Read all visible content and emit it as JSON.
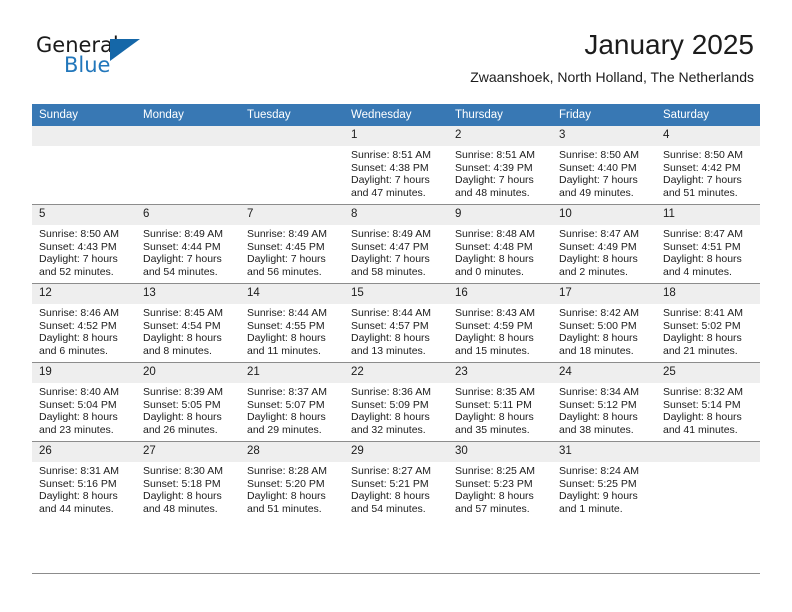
{
  "brand": {
    "name_top": "General",
    "name_bottom": "Blue",
    "logo_icon": "triangle-icon",
    "accent_color": "#1567a8",
    "blue_text_color": "#2277bb"
  },
  "header": {
    "title": "January 2025",
    "subtitle": "Zwaanshoek, North Holland, The Netherlands"
  },
  "calendar": {
    "header_background": "#3878b4",
    "header_text_color": "#ffffff",
    "daynum_background": "#eeeeee",
    "weekday_headers": [
      "Sunday",
      "Monday",
      "Tuesday",
      "Wednesday",
      "Thursday",
      "Friday",
      "Saturday"
    ],
    "weeks": [
      [
        {
          "day": "",
          "sunrise": "",
          "sunset": "",
          "daylight_line1": "",
          "daylight_line2": ""
        },
        {
          "day": "",
          "sunrise": "",
          "sunset": "",
          "daylight_line1": "",
          "daylight_line2": ""
        },
        {
          "day": "",
          "sunrise": "",
          "sunset": "",
          "daylight_line1": "",
          "daylight_line2": ""
        },
        {
          "day": "1",
          "sunrise": "Sunrise: 8:51 AM",
          "sunset": "Sunset: 4:38 PM",
          "daylight_line1": "Daylight: 7 hours",
          "daylight_line2": "and 47 minutes."
        },
        {
          "day": "2",
          "sunrise": "Sunrise: 8:51 AM",
          "sunset": "Sunset: 4:39 PM",
          "daylight_line1": "Daylight: 7 hours",
          "daylight_line2": "and 48 minutes."
        },
        {
          "day": "3",
          "sunrise": "Sunrise: 8:50 AM",
          "sunset": "Sunset: 4:40 PM",
          "daylight_line1": "Daylight: 7 hours",
          "daylight_line2": "and 49 minutes."
        },
        {
          "day": "4",
          "sunrise": "Sunrise: 8:50 AM",
          "sunset": "Sunset: 4:42 PM",
          "daylight_line1": "Daylight: 7 hours",
          "daylight_line2": "and 51 minutes."
        }
      ],
      [
        {
          "day": "5",
          "sunrise": "Sunrise: 8:50 AM",
          "sunset": "Sunset: 4:43 PM",
          "daylight_line1": "Daylight: 7 hours",
          "daylight_line2": "and 52 minutes."
        },
        {
          "day": "6",
          "sunrise": "Sunrise: 8:49 AM",
          "sunset": "Sunset: 4:44 PM",
          "daylight_line1": "Daylight: 7 hours",
          "daylight_line2": "and 54 minutes."
        },
        {
          "day": "7",
          "sunrise": "Sunrise: 8:49 AM",
          "sunset": "Sunset: 4:45 PM",
          "daylight_line1": "Daylight: 7 hours",
          "daylight_line2": "and 56 minutes."
        },
        {
          "day": "8",
          "sunrise": "Sunrise: 8:49 AM",
          "sunset": "Sunset: 4:47 PM",
          "daylight_line1": "Daylight: 7 hours",
          "daylight_line2": "and 58 minutes."
        },
        {
          "day": "9",
          "sunrise": "Sunrise: 8:48 AM",
          "sunset": "Sunset: 4:48 PM",
          "daylight_line1": "Daylight: 8 hours",
          "daylight_line2": "and 0 minutes."
        },
        {
          "day": "10",
          "sunrise": "Sunrise: 8:47 AM",
          "sunset": "Sunset: 4:49 PM",
          "daylight_line1": "Daylight: 8 hours",
          "daylight_line2": "and 2 minutes."
        },
        {
          "day": "11",
          "sunrise": "Sunrise: 8:47 AM",
          "sunset": "Sunset: 4:51 PM",
          "daylight_line1": "Daylight: 8 hours",
          "daylight_line2": "and 4 minutes."
        }
      ],
      [
        {
          "day": "12",
          "sunrise": "Sunrise: 8:46 AM",
          "sunset": "Sunset: 4:52 PM",
          "daylight_line1": "Daylight: 8 hours",
          "daylight_line2": "and 6 minutes."
        },
        {
          "day": "13",
          "sunrise": "Sunrise: 8:45 AM",
          "sunset": "Sunset: 4:54 PM",
          "daylight_line1": "Daylight: 8 hours",
          "daylight_line2": "and 8 minutes."
        },
        {
          "day": "14",
          "sunrise": "Sunrise: 8:44 AM",
          "sunset": "Sunset: 4:55 PM",
          "daylight_line1": "Daylight: 8 hours",
          "daylight_line2": "and 11 minutes."
        },
        {
          "day": "15",
          "sunrise": "Sunrise: 8:44 AM",
          "sunset": "Sunset: 4:57 PM",
          "daylight_line1": "Daylight: 8 hours",
          "daylight_line2": "and 13 minutes."
        },
        {
          "day": "16",
          "sunrise": "Sunrise: 8:43 AM",
          "sunset": "Sunset: 4:59 PM",
          "daylight_line1": "Daylight: 8 hours",
          "daylight_line2": "and 15 minutes."
        },
        {
          "day": "17",
          "sunrise": "Sunrise: 8:42 AM",
          "sunset": "Sunset: 5:00 PM",
          "daylight_line1": "Daylight: 8 hours",
          "daylight_line2": "and 18 minutes."
        },
        {
          "day": "18",
          "sunrise": "Sunrise: 8:41 AM",
          "sunset": "Sunset: 5:02 PM",
          "daylight_line1": "Daylight: 8 hours",
          "daylight_line2": "and 21 minutes."
        }
      ],
      [
        {
          "day": "19",
          "sunrise": "Sunrise: 8:40 AM",
          "sunset": "Sunset: 5:04 PM",
          "daylight_line1": "Daylight: 8 hours",
          "daylight_line2": "and 23 minutes."
        },
        {
          "day": "20",
          "sunrise": "Sunrise: 8:39 AM",
          "sunset": "Sunset: 5:05 PM",
          "daylight_line1": "Daylight: 8 hours",
          "daylight_line2": "and 26 minutes."
        },
        {
          "day": "21",
          "sunrise": "Sunrise: 8:37 AM",
          "sunset": "Sunset: 5:07 PM",
          "daylight_line1": "Daylight: 8 hours",
          "daylight_line2": "and 29 minutes."
        },
        {
          "day": "22",
          "sunrise": "Sunrise: 8:36 AM",
          "sunset": "Sunset: 5:09 PM",
          "daylight_line1": "Daylight: 8 hours",
          "daylight_line2": "and 32 minutes."
        },
        {
          "day": "23",
          "sunrise": "Sunrise: 8:35 AM",
          "sunset": "Sunset: 5:11 PM",
          "daylight_line1": "Daylight: 8 hours",
          "daylight_line2": "and 35 minutes."
        },
        {
          "day": "24",
          "sunrise": "Sunrise: 8:34 AM",
          "sunset": "Sunset: 5:12 PM",
          "daylight_line1": "Daylight: 8 hours",
          "daylight_line2": "and 38 minutes."
        },
        {
          "day": "25",
          "sunrise": "Sunrise: 8:32 AM",
          "sunset": "Sunset: 5:14 PM",
          "daylight_line1": "Daylight: 8 hours",
          "daylight_line2": "and 41 minutes."
        }
      ],
      [
        {
          "day": "26",
          "sunrise": "Sunrise: 8:31 AM",
          "sunset": "Sunset: 5:16 PM",
          "daylight_line1": "Daylight: 8 hours",
          "daylight_line2": "and 44 minutes."
        },
        {
          "day": "27",
          "sunrise": "Sunrise: 8:30 AM",
          "sunset": "Sunset: 5:18 PM",
          "daylight_line1": "Daylight: 8 hours",
          "daylight_line2": "and 48 minutes."
        },
        {
          "day": "28",
          "sunrise": "Sunrise: 8:28 AM",
          "sunset": "Sunset: 5:20 PM",
          "daylight_line1": "Daylight: 8 hours",
          "daylight_line2": "and 51 minutes."
        },
        {
          "day": "29",
          "sunrise": "Sunrise: 8:27 AM",
          "sunset": "Sunset: 5:21 PM",
          "daylight_line1": "Daylight: 8 hours",
          "daylight_line2": "and 54 minutes."
        },
        {
          "day": "30",
          "sunrise": "Sunrise: 8:25 AM",
          "sunset": "Sunset: 5:23 PM",
          "daylight_line1": "Daylight: 8 hours",
          "daylight_line2": "and 57 minutes."
        },
        {
          "day": "31",
          "sunrise": "Sunrise: 8:24 AM",
          "sunset": "Sunset: 5:25 PM",
          "daylight_line1": "Daylight: 9 hours",
          "daylight_line2": "and 1 minute."
        },
        {
          "day": "",
          "sunrise": "",
          "sunset": "",
          "daylight_line1": "",
          "daylight_line2": ""
        }
      ]
    ]
  }
}
